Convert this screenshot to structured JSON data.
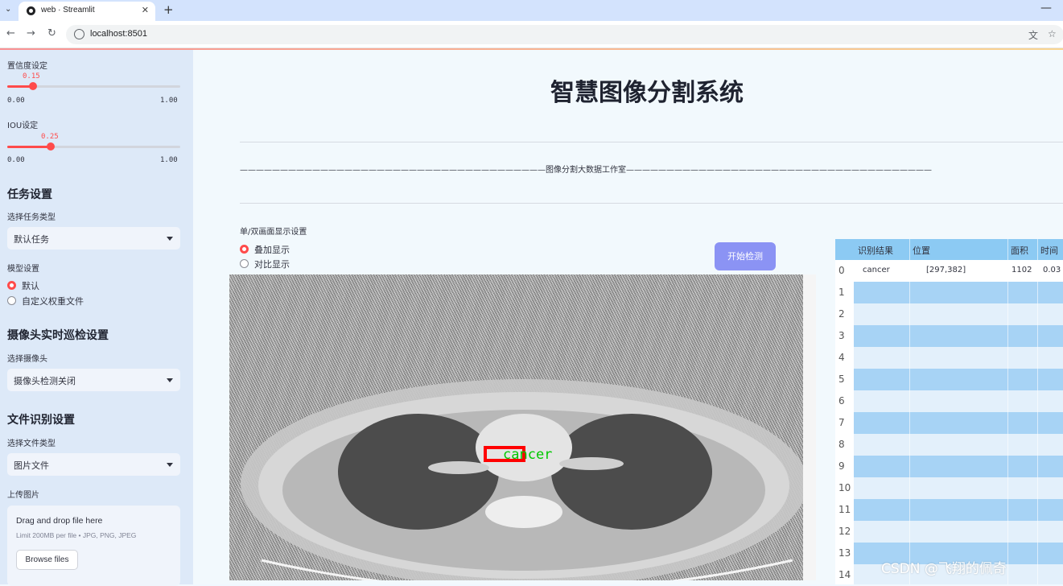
{
  "browser": {
    "tab_title": "web · Streamlit",
    "url": "localhost:8501"
  },
  "sidebar": {
    "conf_label": "置信度设定",
    "conf_value": "0.15",
    "conf_fraction": 0.15,
    "conf_min": "0.00",
    "conf_max": "1.00",
    "iou_label": "IOU设定",
    "iou_value": "0.25",
    "iou_fraction": 0.25,
    "iou_min": "0.00",
    "iou_max": "1.00",
    "task_section": "任务设置",
    "task_type_label": "选择任务类型",
    "task_type_value": "默认任务",
    "model_label": "模型设置",
    "model_options": [
      "默认",
      "自定义权重文件"
    ],
    "camera_section": "摄像头实时巡检设置",
    "camera_label": "选择摄像头",
    "camera_value": "摄像头检测关闭",
    "file_section": "文件识别设置",
    "file_type_label": "选择文件类型",
    "file_type_value": "图片文件",
    "upload_label": "上传图片",
    "upload_title": "Drag and drop file here",
    "upload_limit": "Limit 200MB per file • JPG, PNG, JPEG",
    "browse_label": "Browse files"
  },
  "main": {
    "title": "智慧图像分割系统",
    "dash_text": "——————————————————————————————————————图像分割大数据工作室——————————————————————————————————————",
    "mode_label": "单/双画面显示设置",
    "mode_options": [
      "叠加显示",
      "对比显示"
    ],
    "start_button": "开始检测",
    "detection_label": "cancer"
  },
  "table": {
    "headers": [
      "识别结果",
      "位置",
      "面积",
      "时间"
    ],
    "rows": [
      {
        "index": "0",
        "result": "cancer",
        "position": "[297,382]",
        "area": "1102",
        "time": "0.03"
      },
      {
        "index": "1"
      },
      {
        "index": "2"
      },
      {
        "index": "3"
      },
      {
        "index": "4"
      },
      {
        "index": "5"
      },
      {
        "index": "6"
      },
      {
        "index": "7"
      },
      {
        "index": "8"
      },
      {
        "index": "9"
      },
      {
        "index": "10"
      },
      {
        "index": "11"
      },
      {
        "index": "12"
      },
      {
        "index": "13"
      },
      {
        "index": "14"
      }
    ]
  },
  "watermark": "CSDN @飞翔的佩奇",
  "colors": {
    "accent": "#ff4b4b",
    "button": "#8b93f4",
    "table_header": "#8ccaf3",
    "detection_box": "#ff0000",
    "detection_text": "#00c800"
  }
}
